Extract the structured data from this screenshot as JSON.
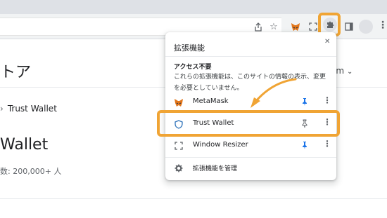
{
  "page": {
    "title_partial": "トア",
    "breadcrumb_last": "Trust Wallet",
    "heading_partial": "Wallet",
    "users_partial": "数: 200,000+ 人",
    "right_text_partial": "om"
  },
  "popup": {
    "title": "拡張機能",
    "access_heading": "アクセス不要",
    "access_description": "これらの拡張機能は、このサイトの情報の表示、変更を必要としていません。",
    "extensions": [
      {
        "name": "MetaMask",
        "icon": "fox-icon",
        "pinned": true
      },
      {
        "name": "Trust Wallet",
        "icon": "shield-icon",
        "pinned": false
      },
      {
        "name": "Window Resizer",
        "icon": "resize-icon",
        "pinned": true
      }
    ],
    "manage_label": "拡張機能を管理"
  },
  "colors": {
    "highlight": "#f0a434",
    "pin_blue": "#1a73e8",
    "chrome_bg": "#f1f3f4"
  }
}
